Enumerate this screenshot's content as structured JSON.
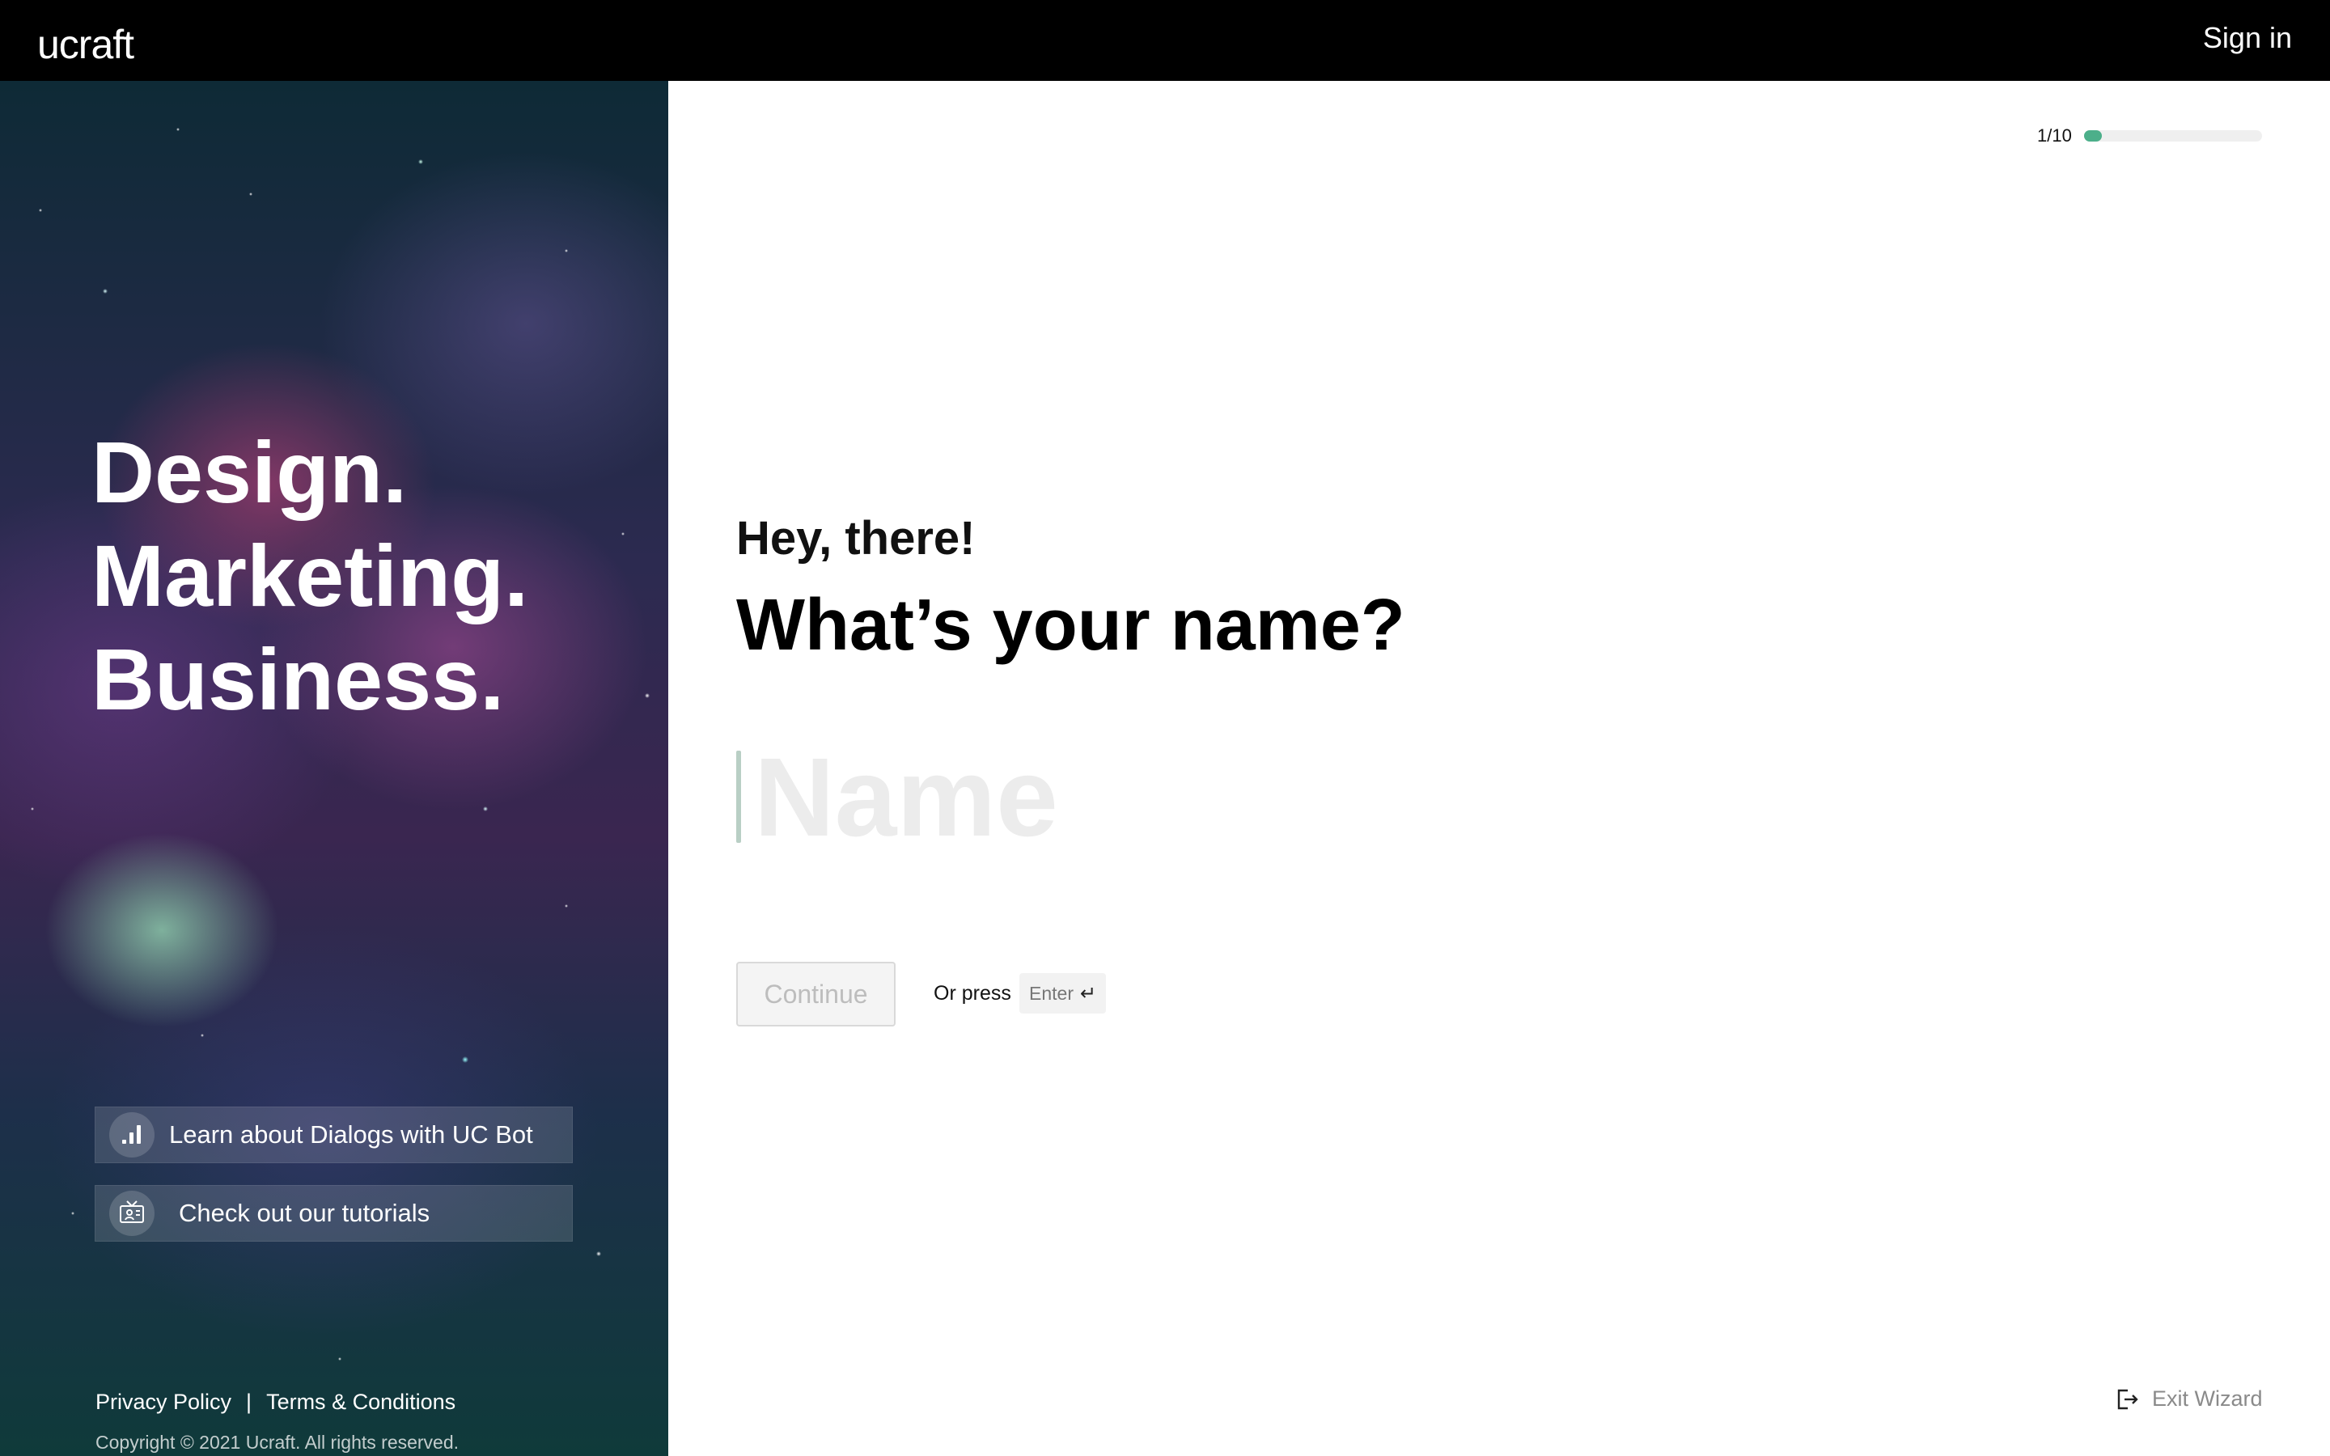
{
  "header": {
    "logo": "ucraft",
    "sign_in": "Sign in"
  },
  "sidebar": {
    "tagline": [
      "Design.",
      "Marketing.",
      "Business."
    ],
    "help_buttons": [
      {
        "label": "Learn about Dialogs with UC Bot",
        "icon": "bot-bars-icon"
      },
      {
        "label": "Check out our tutorials",
        "icon": "tv-tutorial-icon"
      }
    ],
    "footer": {
      "privacy": "Privacy Policy",
      "separator": "|",
      "terms": "Terms & Conditions",
      "copyright": "Copyright © 2021 Ucraft. All rights reserved."
    }
  },
  "wizard": {
    "progress": {
      "label": "1/10",
      "current": 1,
      "total": 10,
      "fraction": 0.1,
      "color": "#4caf8a"
    },
    "greeting": "Hey, there!",
    "question": "What’s your name?",
    "name_input": {
      "value": "",
      "placeholder": "Name"
    },
    "continue_label": "Continue",
    "or_press": "Or press",
    "enter_key": "Enter",
    "enter_symbol": "↵",
    "exit_label": "Exit Wizard"
  }
}
